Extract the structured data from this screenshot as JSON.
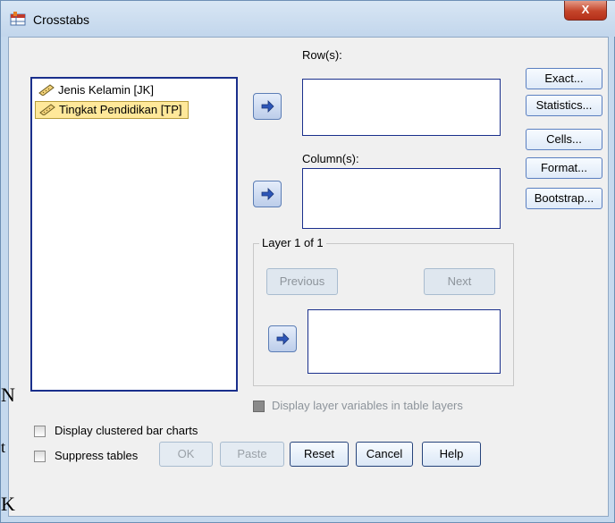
{
  "window": {
    "title": "Crosstabs",
    "close_label": "X"
  },
  "source_list": {
    "items": [
      {
        "label": "Jenis Kelamin [JK]",
        "selected": false
      },
      {
        "label": "Tingkat Pendidikan [TP]",
        "selected": true
      }
    ]
  },
  "rows": {
    "label": "Row(s):"
  },
  "columns": {
    "label": "Column(s):"
  },
  "layer": {
    "title": "Layer 1 of 1",
    "previous_label": "Previous",
    "next_label": "Next"
  },
  "side_buttons": {
    "exact": "Exact...",
    "statistics": "Statistics...",
    "cells": "Cells...",
    "format": "Format...",
    "bootstrap": "Bootstrap..."
  },
  "options": {
    "display_layer": {
      "label": "Display layer variables in table layers",
      "checked": false,
      "enabled": false
    },
    "clustered_bar": {
      "label": "Display clustered bar charts",
      "checked": false
    },
    "suppress_tables": {
      "label": "Suppress tables",
      "checked": false
    }
  },
  "bottom_buttons": {
    "ok": "OK",
    "paste": "Paste",
    "reset": "Reset",
    "cancel": "Cancel",
    "help": "Help"
  },
  "background_text": {
    "line1": "N",
    "line2": "t",
    "line3": "K"
  },
  "colors": {
    "selection": "#ffe89a",
    "list_border": "#1a2f8c",
    "titlebar": "#c5d9ee",
    "close": "#c4442a"
  },
  "icons": {
    "title": "crosstabs-table-icon",
    "variable": "scale-ruler-icon",
    "move": "right-arrow-icon"
  }
}
